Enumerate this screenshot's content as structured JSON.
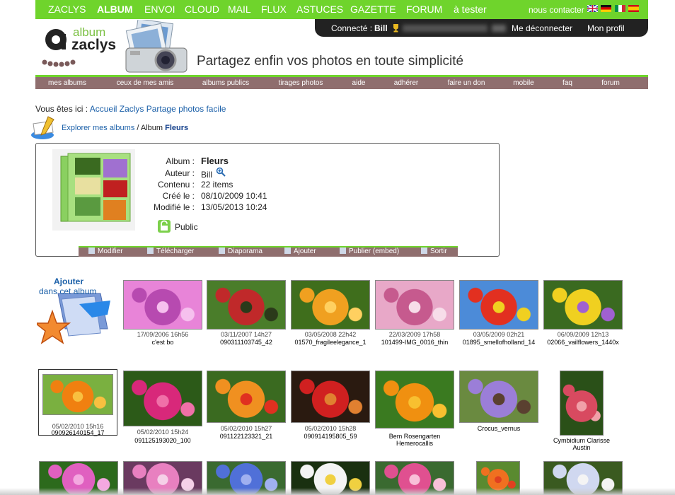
{
  "topnav": {
    "items": [
      "ZACLYS",
      "ALBUM",
      "ENVOI",
      "CLOUD",
      "MAIL",
      "FLUX",
      "ASTUCES",
      "GAZETTE",
      "FORUM",
      "à tester"
    ],
    "active": "ALBUM",
    "contact": "nous contacter",
    "flags": [
      "english-flag-icon",
      "german-flag-icon",
      "italian-flag-icon",
      "spanish-flag-icon"
    ]
  },
  "userbar": {
    "connected_label": "Connecté :",
    "user": "Bill",
    "logout": "Me déconnecter",
    "profile": "Mon profil"
  },
  "header": {
    "logo_top": "album",
    "logo_bottom": "zaclys",
    "tagline": "Partagez enfin vos photos en toute simplicité"
  },
  "subnav": [
    "mes albums",
    "ceux de mes amis",
    "albums publics",
    "tirages photos",
    "aide",
    "adhérer",
    "faire un don",
    "mobile",
    "faq",
    "forum"
  ],
  "breadcrumb": {
    "prefix": "Vous êtes ici :",
    "link": "Accueil Zaclys Partage photos facile",
    "explore": "Explorer mes albums",
    "sep": "/ Album",
    "album": "Fleurs"
  },
  "album": {
    "labels": [
      "Album :",
      "Auteur :",
      "Contenu :",
      "Créé le :",
      "Modifié le :"
    ],
    "name": "Fleurs",
    "author": "Bill",
    "content": "22 items",
    "created": "08/10/2009 10:41",
    "modified": "13/05/2013 10:24",
    "visibility": "Public"
  },
  "actions": [
    "Modifier",
    "Télécharger",
    "Diaporama",
    "Ajouter",
    "Publier (embed)",
    "Sortir"
  ],
  "add_album": {
    "line1": "Ajouter",
    "line2": "dans cet album"
  },
  "photos": [
    {
      "date": "17/09/2006 16h56",
      "name": "c'est bo",
      "colors": [
        "#e884d8",
        "#b74ab0",
        "#f6c0ee"
      ]
    },
    {
      "date": "03/11/2007 14h27",
      "name": "090311103745_42",
      "colors": [
        "#4a7d2a",
        "#c0292a",
        "#2b3a1a"
      ]
    },
    {
      "date": "03/05/2008 22h42",
      "name": "01570_fragileelegance_1",
      "colors": [
        "#3f6e1c",
        "#f0a020",
        "#ffd060"
      ]
    },
    {
      "date": "22/03/2009 17h58",
      "name": "101499-IMG_0016_thin",
      "colors": [
        "#e8a8c8",
        "#c65a8e",
        "#f7dde9"
      ]
    },
    {
      "date": "03/05/2009 02h21",
      "name": "01895_smellofholland_14",
      "colors": [
        "#4c8bd8",
        "#e23020",
        "#f0d020"
      ]
    },
    {
      "date": "06/09/2009 12h13",
      "name": "02066_vailflowers_1440x",
      "colors": [
        "#3a6a20",
        "#f0d020",
        "#a060d0"
      ]
    },
    {
      "date": "05/02/2010 15h16",
      "name": "090926140154_17",
      "colors": [
        "#7ab040",
        "#f08010",
        "#f8c040"
      ]
    },
    {
      "date": "05/02/2010 15h24",
      "name": "091125193020_100",
      "colors": [
        "#2c5a18",
        "#d8287a",
        "#f070a8"
      ]
    },
    {
      "date": "05/02/2010 15h27",
      "name": "091122123321_21",
      "colors": [
        "#3a6a20",
        "#f09020",
        "#e03020"
      ]
    },
    {
      "date": "05/02/2010 15h28",
      "name": "090914195805_59",
      "colors": [
        "#2a1a10",
        "#d02020",
        "#e08030"
      ]
    },
    {
      "date": "",
      "name": "Bem Rosengarten Hemerocallis",
      "colors": [
        "#3a7a20",
        "#f09010",
        "#f8c030"
      ]
    },
    {
      "date": "",
      "name": "Crocus_vernus",
      "colors": [
        "#6a8a40",
        "#9b7ed8",
        "#5a4030"
      ]
    },
    {
      "date": "",
      "name": "Cymbidium Clarisse Austin",
      "colors": [
        "#2a5018",
        "#d84a60",
        "#f0a0a8"
      ]
    },
    {
      "date": "",
      "name": "",
      "colors": [
        "#2c6a1c",
        "#e060c0",
        "#f4a8e0"
      ]
    },
    {
      "date": "",
      "name": "",
      "colors": [
        "#6a3a60",
        "#e880c0",
        "#f5d0e8"
      ]
    },
    {
      "date": "",
      "name": "",
      "colors": [
        "#3a6a30",
        "#5070d8",
        "#a0b0f0"
      ]
    },
    {
      "date": "",
      "name": "",
      "colors": [
        "#1a3010",
        "#f4f4f4",
        "#f0d040"
      ]
    },
    {
      "date": "",
      "name": "",
      "colors": [
        "#3a6a30",
        "#e05090",
        "#f8c0d8"
      ]
    },
    {
      "date": "",
      "name": "",
      "colors": [
        "#5a8a30",
        "#f07020",
        "#e04020"
      ]
    },
    {
      "date": "",
      "name": "",
      "colors": [
        "#3a5a20",
        "#d0d8f0",
        "#f4f4f4"
      ]
    }
  ]
}
